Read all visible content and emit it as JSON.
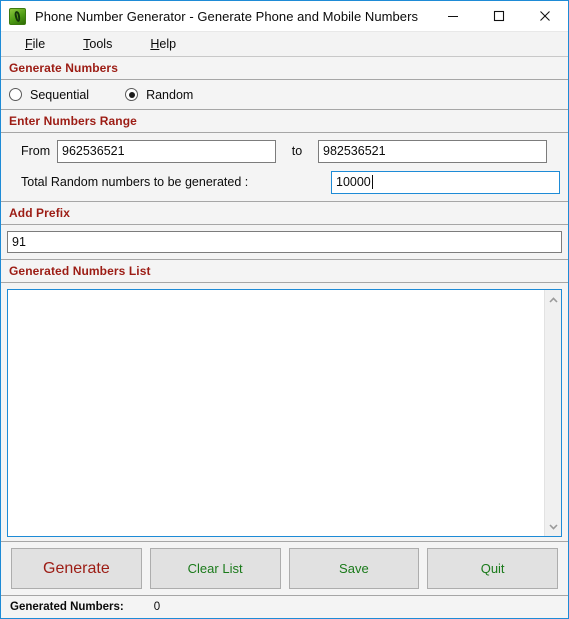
{
  "window": {
    "title": "Phone Number Generator - Generate Phone and Mobile Numbers",
    "app_icon": "phone-icon",
    "accent_border_color": "#1e8bd6",
    "header_text_color": "#9c1c14",
    "button_text_color": "#1a7a1a"
  },
  "window_controls": {
    "minimize": "minimize-icon",
    "maximize": "maximize-icon",
    "close": "close-icon"
  },
  "menu": {
    "items": [
      {
        "label": "File",
        "accel": "F",
        "rest": "ile"
      },
      {
        "label": "Tools",
        "accel": "T",
        "rest": "ools"
      },
      {
        "label": "Help",
        "accel": "H",
        "rest": "elp"
      }
    ]
  },
  "sections": {
    "generate_numbers": {
      "heading": "Generate Numbers",
      "options": [
        {
          "label": "Sequential",
          "selected": false
        },
        {
          "label": "Random",
          "selected": true
        }
      ]
    },
    "numbers_range": {
      "heading": "Enter Numbers Range",
      "from_label": "From",
      "from_value": "962536521",
      "to_label": "to",
      "to_value": "982536521",
      "total_label": "Total Random numbers to be generated :",
      "total_value": "10000",
      "total_focused": true
    },
    "add_prefix": {
      "heading": "Add Prefix",
      "value": "91"
    },
    "generated_list": {
      "heading": "Generated Numbers List",
      "content": "",
      "scroll_up": "chevron-up-icon",
      "scroll_down": "chevron-down-icon"
    }
  },
  "buttons": [
    {
      "name": "generate",
      "label": "Generate",
      "primary": true
    },
    {
      "name": "clear-list",
      "label": "Clear List",
      "primary": false
    },
    {
      "name": "save",
      "label": "Save",
      "primary": false
    },
    {
      "name": "quit",
      "label": "Quit",
      "primary": false
    }
  ],
  "statusbar": {
    "label": "Generated Numbers:",
    "value": "0"
  }
}
